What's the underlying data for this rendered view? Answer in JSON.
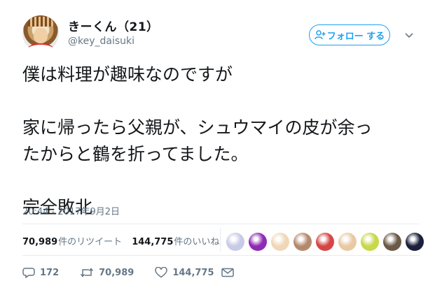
{
  "user": {
    "display_name": "きーくん（21）",
    "handle": "@key_daisuki"
  },
  "follow_button": {
    "label": "フォロー する"
  },
  "tweet": {
    "lines": [
      "僕は料理が趣味なのですが",
      "家に帰ったら父親が、シュウマイの皮が余っ",
      "たからと鶴を折ってました。",
      "完全敗北"
    ],
    "timestamp": "20:44 - 2017年9月2日"
  },
  "stats": {
    "retweets_count": "70,989",
    "retweets_label": "件のリツイート",
    "likes_count": "144,775",
    "likes_label": "件のいいね"
  },
  "likers": [
    {
      "name": "liker-avatar-1",
      "color": "#c8cbe6"
    },
    {
      "name": "liker-avatar-2",
      "color": "#8e2bb4"
    },
    {
      "name": "liker-avatar-3",
      "color": "#f0d7b8"
    },
    {
      "name": "liker-avatar-4",
      "color": "#b48a6e"
    },
    {
      "name": "liker-avatar-5",
      "color": "#d64545"
    },
    {
      "name": "liker-avatar-6",
      "color": "#e8c9a4"
    },
    {
      "name": "liker-avatar-7",
      "color": "#c7d84a"
    },
    {
      "name": "liker-avatar-8",
      "color": "#6b5a48"
    },
    {
      "name": "liker-avatar-9",
      "color": "#1b1f3a"
    }
  ],
  "actions": {
    "reply_count": "172",
    "retweet_count": "70,989",
    "like_count": "144,775"
  },
  "colors": {
    "accent": "#1da1f2",
    "muted": "#657786",
    "text": "#14171a"
  }
}
